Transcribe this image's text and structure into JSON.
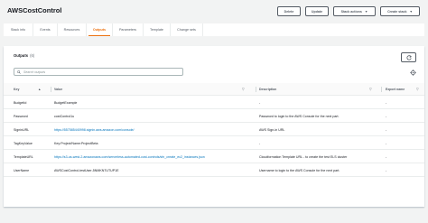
{
  "header": {
    "title": "AWSCostControl"
  },
  "actions": {
    "delete": "Delete",
    "update": "Update",
    "stack_actions": "Stack actions",
    "create_stack": "Create stack"
  },
  "tabs": [
    {
      "label": "Stack info"
    },
    {
      "label": "Events"
    },
    {
      "label": "Resources"
    },
    {
      "label": "Outputs"
    },
    {
      "label": "Parameters"
    },
    {
      "label": "Template"
    },
    {
      "label": "Change sets"
    }
  ],
  "active_tab": "Outputs",
  "outputs": {
    "title": "Outputs",
    "count": "(6)",
    "search_placeholder": "Search outputs",
    "columns": {
      "key": "Key",
      "value": "Value",
      "description": "Description",
      "export_name": "Export name"
    },
    "rows": [
      {
        "key": "BudgetId",
        "value": "BudgetExample",
        "value_is_link": false,
        "description": "-",
        "export_name": "-"
      },
      {
        "key": "Password",
        "value": "costControl1u",
        "value_is_link": false,
        "description": "Password to login to the AWS Console for the next part.",
        "export_name": "-"
      },
      {
        "key": "SigninURL",
        "value": "https://557585440998.signin.aws.amazon.com/console/",
        "value_is_link": true,
        "description": "AWS Sign-in URL",
        "export_name": "-"
      },
      {
        "key": "TagKeyValue",
        "value": "Key:Project/Name:ProjectBeta",
        "value_is_link": false,
        "description": "-",
        "export_name": "-"
      },
      {
        "key": "TemplateURL",
        "value": "https://s3-us-west-2.amazonaws.com/serverless-automated-cost-controls/sfn_create_ec2_instances.json",
        "value_is_link": true,
        "description": "Cloudformation Template URL - to create the test ELS cluster",
        "export_name": "-"
      },
      {
        "key": "UserName",
        "value": "AWSCostControl-testUser-5NMKN7UTUP1E",
        "value_is_link": false,
        "description": "Username to login to the AWS Console for the next part.",
        "export_name": "-"
      }
    ]
  },
  "colors": {
    "accent": "#ec7211",
    "link": "#0073bb",
    "background": "#f2f3f3"
  },
  "icons": {
    "refresh": "refresh-icon",
    "search": "search-icon",
    "settings": "gear-icon",
    "dropdown": "caret-down-icon",
    "sort": "sort-up-icon",
    "filter": "filter-icon"
  }
}
